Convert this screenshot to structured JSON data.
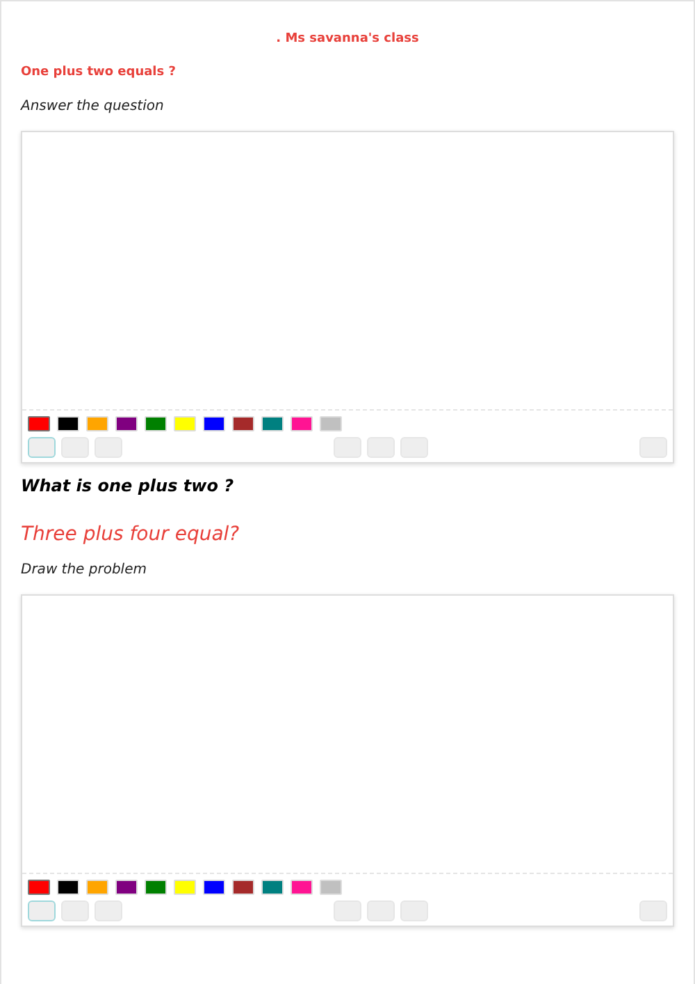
{
  "title": ". Ms savanna's class",
  "blocks": [
    {
      "kind": "label",
      "text": "One plus two equals ?"
    },
    {
      "kind": "instruction",
      "text": "Answer the question"
    },
    {
      "kind": "board",
      "colors": [
        {
          "color": "#ff0000",
          "selected": true
        },
        {
          "color": "#000000",
          "selected": false
        },
        {
          "color": "#ffa500",
          "selected": false
        },
        {
          "color": "#800080",
          "selected": false
        },
        {
          "color": "#008000",
          "selected": false
        },
        {
          "color": "#ffff00",
          "selected": false
        },
        {
          "color": "#0000ff",
          "selected": false
        },
        {
          "color": "#a52a2a",
          "selected": false
        },
        {
          "color": "#008080",
          "selected": false
        },
        {
          "color": "#ff1493",
          "selected": false
        },
        {
          "color": "#c0c0c0",
          "selected": false
        }
      ],
      "tools": {
        "left": [
          {
            "selected": true
          },
          {
            "selected": false
          },
          {
            "selected": false
          }
        ],
        "center": [
          {
            "selected": false
          },
          {
            "selected": false
          },
          {
            "selected": false
          }
        ],
        "right": [
          {
            "selected": false
          }
        ]
      }
    },
    {
      "kind": "question",
      "text": "What is one plus two ?"
    },
    {
      "kind": "subtitle",
      "text": "Three plus four equal?"
    },
    {
      "kind": "instruction",
      "text": "Draw the problem"
    },
    {
      "kind": "board",
      "colors": [
        {
          "color": "#ff0000",
          "selected": true
        },
        {
          "color": "#000000",
          "selected": false
        },
        {
          "color": "#ffa500",
          "selected": false
        },
        {
          "color": "#800080",
          "selected": false
        },
        {
          "color": "#008000",
          "selected": false
        },
        {
          "color": "#ffff00",
          "selected": false
        },
        {
          "color": "#0000ff",
          "selected": false
        },
        {
          "color": "#a52a2a",
          "selected": false
        },
        {
          "color": "#008080",
          "selected": false
        },
        {
          "color": "#ff1493",
          "selected": false
        },
        {
          "color": "#c0c0c0",
          "selected": false
        }
      ],
      "tools": {
        "left": [
          {
            "selected": true
          },
          {
            "selected": false
          },
          {
            "selected": false
          }
        ],
        "center": [
          {
            "selected": false
          },
          {
            "selected": false
          },
          {
            "selected": false
          }
        ],
        "right": [
          {
            "selected": false
          }
        ]
      }
    }
  ]
}
